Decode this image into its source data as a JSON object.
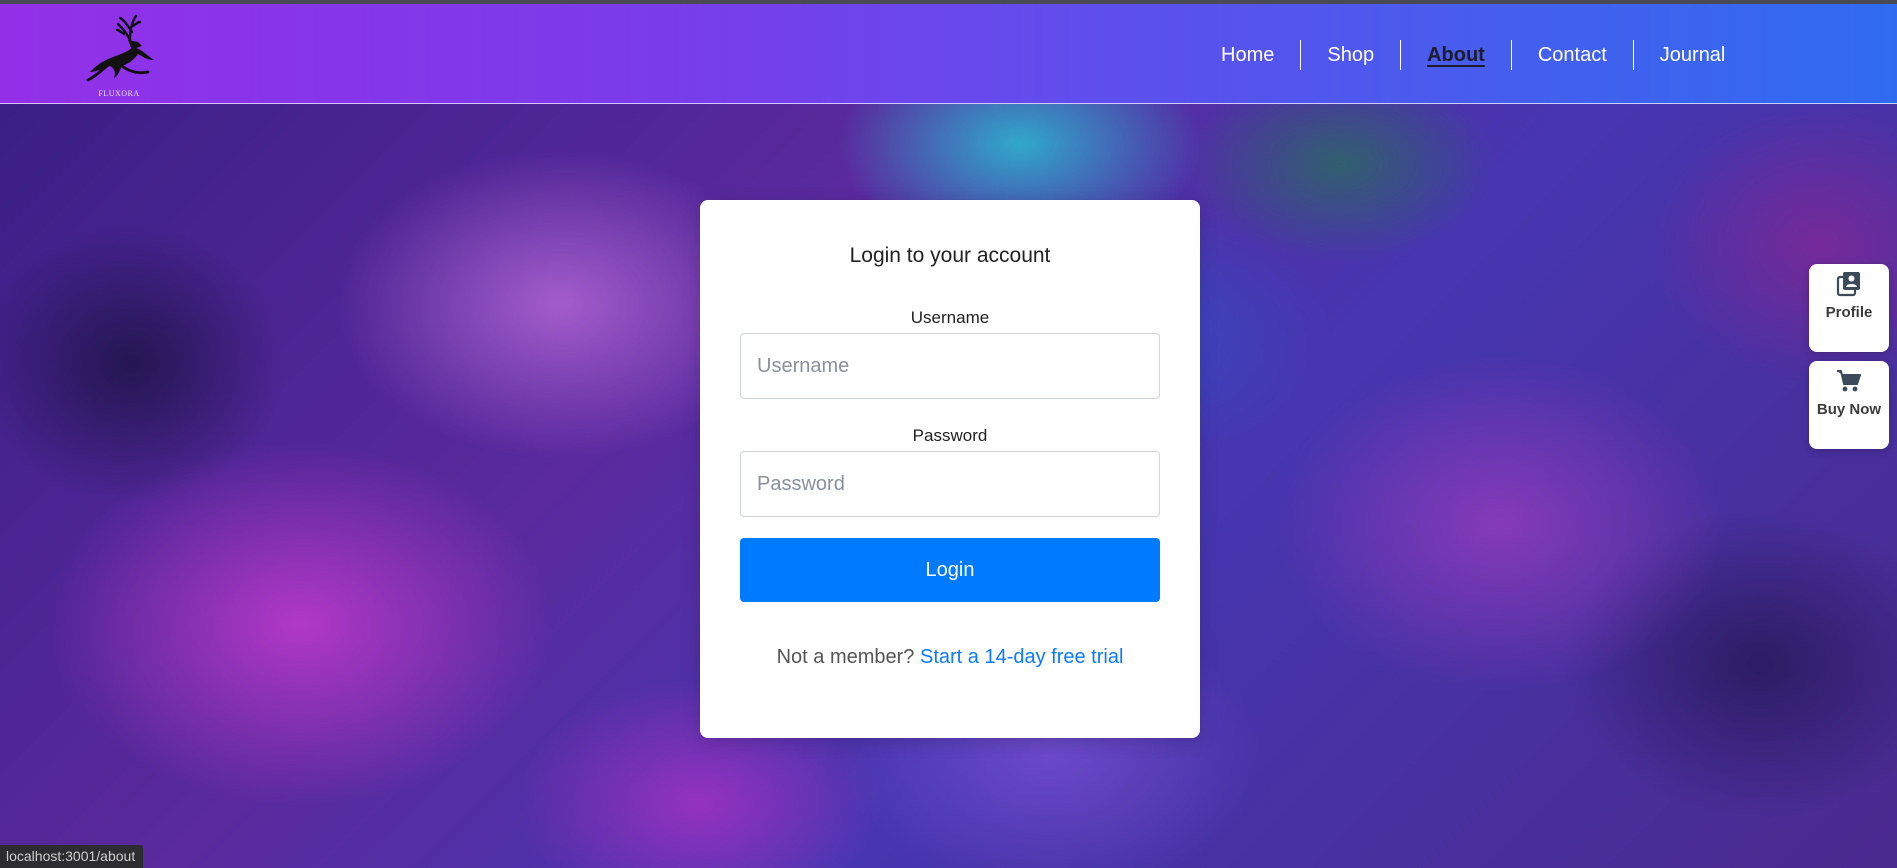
{
  "brand": {
    "logo_text": "FLUXORA",
    "logo_icon": "leaping-deer-icon"
  },
  "nav": {
    "items": [
      {
        "label": "Home"
      },
      {
        "label": "Shop"
      },
      {
        "label": "About",
        "active": true
      },
      {
        "label": "Contact"
      },
      {
        "label": "Journal"
      }
    ]
  },
  "login": {
    "title": "Login to your account",
    "username_label": "Username",
    "username_placeholder": "Username",
    "username_value": "",
    "password_label": "Password",
    "password_placeholder": "Password",
    "password_value": "",
    "submit_label": "Login",
    "signup_prompt": "Not a member?",
    "signup_link": "Start a 14-day free trial"
  },
  "side_actions": {
    "profile_label": "Profile",
    "profile_icon": "profile-card-icon",
    "buy_label": "Buy Now",
    "buy_icon": "shopping-cart-icon"
  },
  "status_bar": {
    "url": "localhost:3001/about"
  },
  "colors": {
    "nav_gradient_start": "#9230e8",
    "nav_gradient_end": "#2f6bf0",
    "primary_button": "#007bff",
    "link": "#0a7bff",
    "active_nav": "#1c1c2a"
  }
}
